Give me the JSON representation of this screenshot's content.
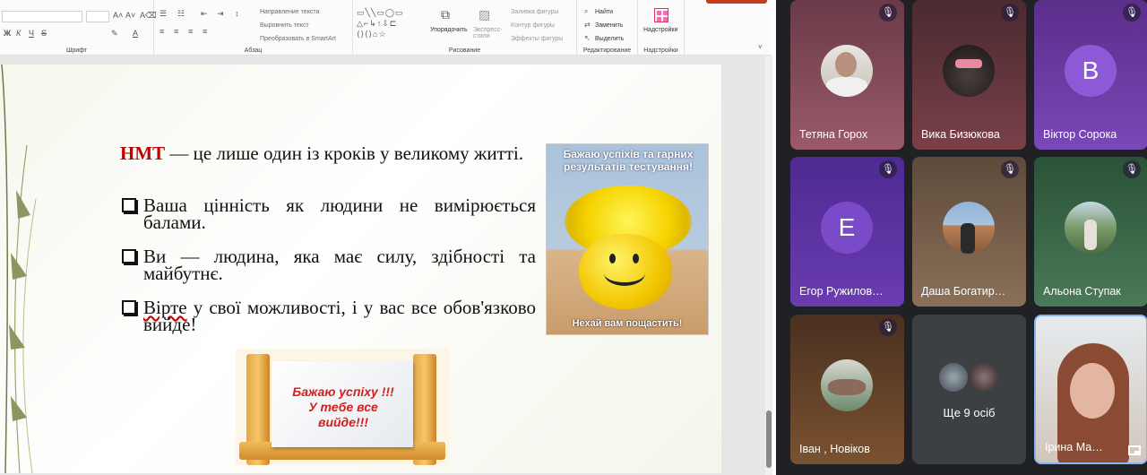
{
  "ribbon": {
    "groups": {
      "font": "Шрифт",
      "paragraph": "Абзац",
      "drawing": "Рисование",
      "editing": "Редактирование",
      "addins": "Надстройки"
    },
    "paragraph_cmds": {
      "text_direction": "Направление текста",
      "align_text": "Выровнить текст",
      "smartart": "Преобразовать в SmartArt"
    },
    "drawing_cmds": {
      "arrange": "Упорядочить",
      "quick_styles": "Экспресс-стили",
      "fill": "Заливка фигуры",
      "outline": "Контур фигуры",
      "effects": "Эффекты фигуры"
    },
    "editing_cmds": {
      "find": "Найти",
      "replace": "Заменить",
      "select": "Выделить"
    },
    "addins_btn": "Надстройки",
    "font_btns": {
      "bold": "Ж",
      "italic": "К",
      "underline": "Ч",
      "strike": "S"
    }
  },
  "slide": {
    "line1_bold": "НМТ",
    "line1_rest": " — це лише один із кроків у великому житті.",
    "b1": "Ваша цінність як людини не вимірюється балами.",
    "b2": "Ви — людина, яка має силу, здібності та майбутнє.",
    "b3_first": "Вірте",
    "b3_rest": " у свої можливості, і у вас все обов'язково вийде!",
    "pic1_top": "Бажаю успіхів та гарних результатів тестування!",
    "pic1_bottom": "Нехай вам пощастить!",
    "sign": "Бажаю успіху !!! У тебе все вийде!!!"
  },
  "participants": [
    {
      "name": "Тетяна Горох",
      "type": "photo",
      "mic": "off",
      "bg": "#8a4a5a"
    },
    {
      "name": "Вика Бизюкова",
      "type": "photo",
      "mic": "off",
      "bg": "#6a3a40"
    },
    {
      "name": "Віктор Сорока",
      "type": "letter",
      "letter": "В",
      "mic": "off",
      "bg": "#6a3aa8",
      "circle": "#8e59d6"
    },
    {
      "name": "Егор Ружилов…",
      "type": "letter",
      "letter": "Е",
      "mic": "off",
      "bg": "#5b2ea0",
      "circle": "#7a4bc8"
    },
    {
      "name": "Даша Богатир…",
      "type": "photo",
      "mic": "off",
      "bg": "#7a6048"
    },
    {
      "name": "Альона Ступак",
      "type": "photo",
      "mic": "off",
      "bg": "#3a6a48"
    },
    {
      "name": "Іван , Новіков",
      "type": "photo",
      "mic": "off",
      "bg": "#6a4a30"
    },
    {
      "name": "Ще 9 осіб",
      "type": "more",
      "bg": "#3c4043"
    },
    {
      "name": "Ірина Ма…",
      "type": "video",
      "bg": "#d8cfc8"
    }
  ],
  "colors": {
    "meet_bg": "#202124",
    "accent": "#8ab4f8",
    "title_red": "#c00000"
  }
}
